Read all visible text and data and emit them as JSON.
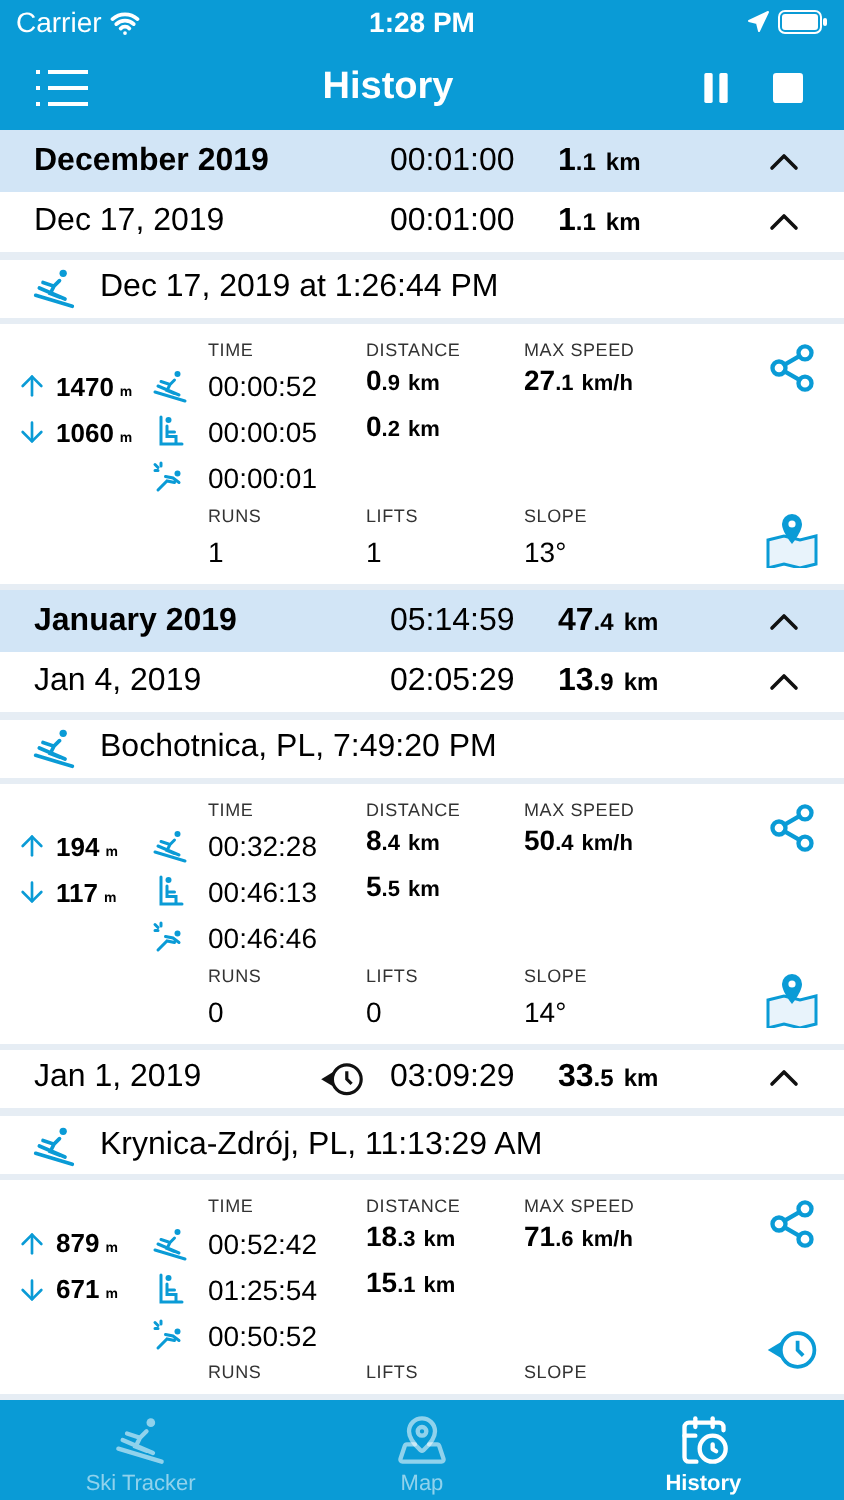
{
  "status_bar": {
    "carrier": "Carrier",
    "time": "1:28 PM"
  },
  "nav": {
    "title": "History"
  },
  "months": [
    {
      "title": "December 2019",
      "time": "00:01:00",
      "distance": {
        "whole": "1",
        "fraction": ".1",
        "unit": "km"
      },
      "expanded": true,
      "days": [
        {
          "title": "Dec 17, 2019",
          "boost": false,
          "time": "00:01:00",
          "distance": {
            "whole": "1",
            "fraction": ".1",
            "unit": "km"
          },
          "expanded": true,
          "sessions": [
            {
              "title": "Dec 17, 2019 at 1:26:44 PM",
              "labels": {
                "time": "TIME",
                "distance": "DISTANCE",
                "max_speed": "MAX SPEED",
                "runs": "RUNS",
                "lifts": "LIFTS",
                "slope": "SLOPE"
              },
              "ascent": "1470",
              "ascent_unit": "m",
              "descent": "1060",
              "descent_unit": "m",
              "ski_time": "00:00:52",
              "lift_time": "00:00:05",
              "rest_time": "00:00:01",
              "ski_distance": {
                "whole": "0",
                "fraction": ".9",
                "unit": "km"
              },
              "lift_distance": {
                "whole": "0",
                "fraction": ".2",
                "unit": "km"
              },
              "max_speed": {
                "whole": "27",
                "fraction": ".1",
                "unit": "km/h"
              },
              "runs": "1",
              "lifts": "1",
              "slope": "13°",
              "actions": [
                {
                  "kind": "share"
                },
                {
                  "kind": "map"
                }
              ]
            }
          ]
        }
      ]
    },
    {
      "title": "January 2019",
      "time": "05:14:59",
      "distance": {
        "whole": "47",
        "fraction": ".4",
        "unit": "km"
      },
      "expanded": true,
      "days": [
        {
          "title": "Jan 4, 2019",
          "boost": false,
          "time": "02:05:29",
          "distance": {
            "whole": "13",
            "fraction": ".9",
            "unit": "km"
          },
          "expanded": true,
          "sessions": [
            {
              "title": "Bochotnica, PL, 7:49:20 PM",
              "labels": {
                "time": "TIME",
                "distance": "DISTANCE",
                "max_speed": "MAX SPEED",
                "runs": "RUNS",
                "lifts": "LIFTS",
                "slope": "SLOPE"
              },
              "ascent": "194",
              "ascent_unit": "m",
              "descent": "117",
              "descent_unit": "m",
              "ski_time": "00:32:28",
              "lift_time": "00:46:13",
              "rest_time": "00:46:46",
              "ski_distance": {
                "whole": "8",
                "fraction": ".4",
                "unit": "km"
              },
              "lift_distance": {
                "whole": "5",
                "fraction": ".5",
                "unit": "km"
              },
              "max_speed": {
                "whole": "50",
                "fraction": ".4",
                "unit": "km/h"
              },
              "runs": "0",
              "lifts": "0",
              "slope": "14°",
              "actions": [
                {
                  "kind": "share"
                },
                {
                  "kind": "map"
                }
              ]
            }
          ]
        },
        {
          "title": "Jan 1, 2019",
          "boost": true,
          "time": "03:09:29",
          "distance": {
            "whole": "33",
            "fraction": ".5",
            "unit": "km"
          },
          "expanded": true,
          "sessions": [
            {
              "title": "Krynica-Zdrój, PL, 11:13:29 AM",
              "labels": {
                "time": "TIME",
                "distance": "DISTANCE",
                "max_speed": "MAX SPEED",
                "runs": "RUNS",
                "lifts": "LIFTS",
                "slope": "SLOPE"
              },
              "ascent": "879",
              "ascent_unit": "m",
              "descent": "671",
              "descent_unit": "m",
              "ski_time": "00:52:42",
              "lift_time": "01:25:54",
              "rest_time": "00:50:52",
              "ski_distance": {
                "whole": "18",
                "fraction": ".3",
                "unit": "km"
              },
              "lift_distance": {
                "whole": "15",
                "fraction": ".1",
                "unit": "km"
              },
              "max_speed": {
                "whole": "71",
                "fraction": ".6",
                "unit": "km/h"
              },
              "actions": [
                {
                  "kind": "share"
                },
                {
                  "kind": "boost"
                }
              ]
            }
          ]
        }
      ]
    }
  ],
  "tabs": [
    {
      "label": "Ski Tracker",
      "kind": "skier",
      "selected": false
    },
    {
      "label": "Map",
      "kind": "map",
      "selected": false
    },
    {
      "label": "History",
      "kind": "history",
      "selected": true
    }
  ]
}
